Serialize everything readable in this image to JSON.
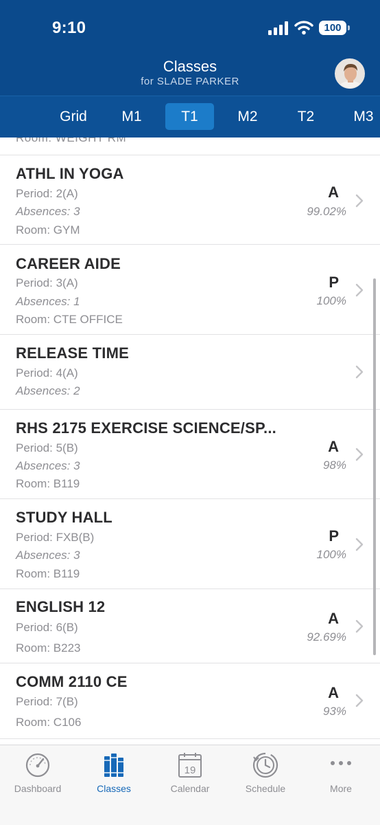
{
  "status_bar": {
    "time": "9:10",
    "battery": "100"
  },
  "header": {
    "title": "Classes",
    "subtitle": "for SLADE PARKER"
  },
  "terms": {
    "items": [
      "Grid",
      "M1",
      "T1",
      "M2",
      "T2",
      "M3"
    ],
    "selected": "T1"
  },
  "partial_row": {
    "room": "Room: WEIGHT RM"
  },
  "classes": [
    {
      "name": "ATHL IN YOGA",
      "period": "Period: 2(A)",
      "absences": "Absences: 3",
      "room": "Room: GYM",
      "grade": "A",
      "percent": "99.02%"
    },
    {
      "name": "CAREER AIDE",
      "period": "Period: 3(A)",
      "absences": "Absences: 1",
      "room": "Room: CTE OFFICE",
      "grade": "P",
      "percent": "100%"
    },
    {
      "name": "RELEASE TIME",
      "period": "Period: 4(A)",
      "absences": "Absences: 2",
      "room": "",
      "grade": "",
      "percent": ""
    },
    {
      "name": "RHS 2175 EXERCISE SCIENCE/SP...",
      "period": "Period: 5(B)",
      "absences": "Absences: 3",
      "room": "Room: B119",
      "grade": "A",
      "percent": "98%"
    },
    {
      "name": "STUDY HALL",
      "period": "Period: FXB(B)",
      "absences": "Absences: 3",
      "room": "Room: B119",
      "grade": "P",
      "percent": "100%"
    },
    {
      "name": "ENGLISH 12",
      "period": "Period: 6(B)",
      "absences": "",
      "room": "Room: B223",
      "grade": "A",
      "percent": "92.69%"
    },
    {
      "name": "COMM 2110 CE",
      "period": "Period: 7(B)",
      "absences": "",
      "room": "Room: C106",
      "grade": "A",
      "percent": "93%"
    }
  ],
  "tab_bar": {
    "items": [
      {
        "label": "Dashboard",
        "icon": "gauge-icon"
      },
      {
        "label": "Classes",
        "icon": "books-icon"
      },
      {
        "label": "Calendar",
        "icon": "calendar-icon",
        "day": "19"
      },
      {
        "label": "Schedule",
        "icon": "clock-history-icon"
      },
      {
        "label": "More",
        "icon": "ellipsis-icon"
      }
    ],
    "selected": "Classes"
  },
  "colors": {
    "header": "#0b4a8c",
    "tabs": "#0d5196",
    "active_tab": "#1c7cc9",
    "active_nav": "#1769b8"
  }
}
